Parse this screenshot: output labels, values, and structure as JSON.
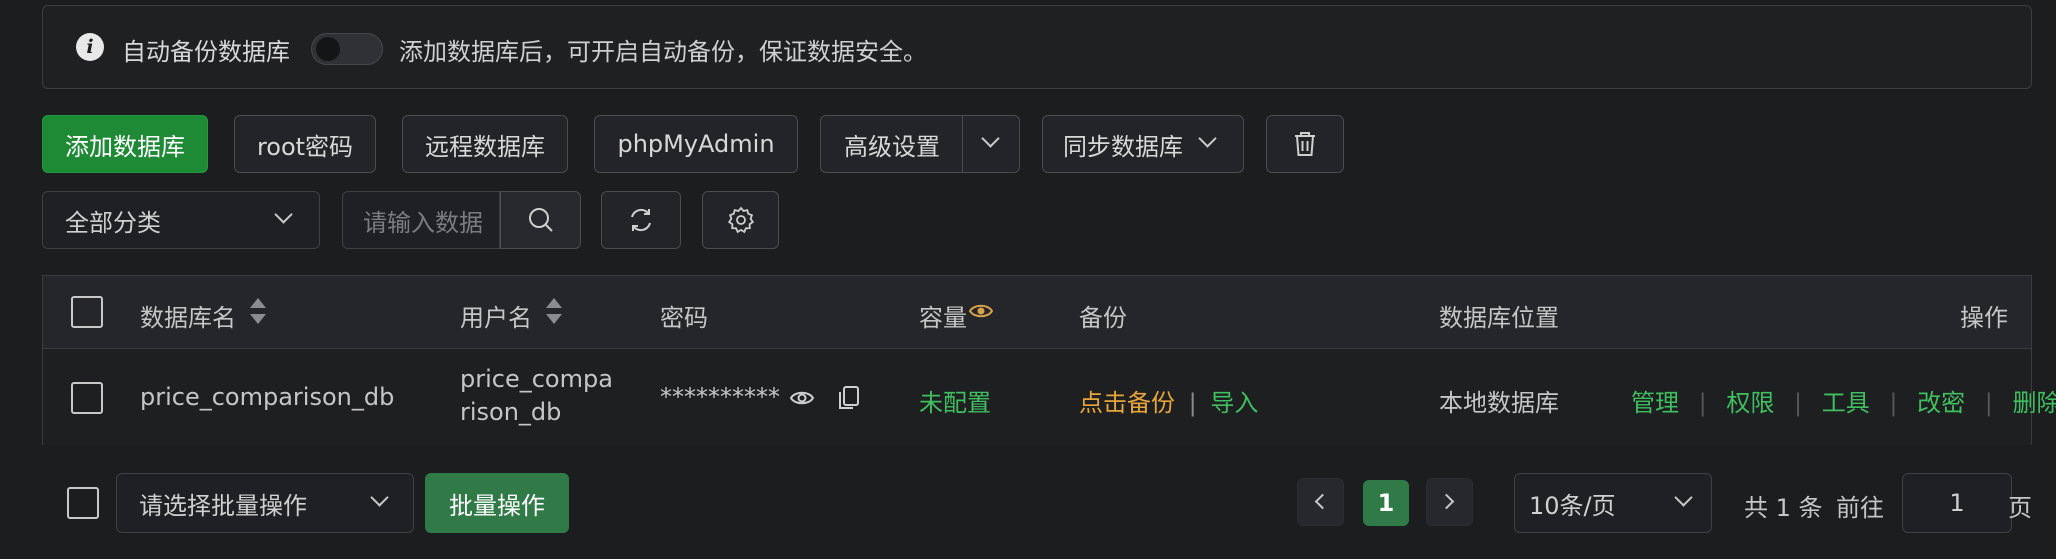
{
  "notice": {
    "label": "自动备份数据库",
    "hint": "添加数据库后，可开启自动备份，保证数据安全。",
    "toggle_on": false
  },
  "toolbar": {
    "add_db": "添加数据库",
    "root_pwd": "root密码",
    "remote_db": "远程数据库",
    "phpmyadmin": "phpMyAdmin",
    "advanced": "高级设置",
    "sync_db": "同步数据库"
  },
  "filter": {
    "category": "全部分类",
    "search_placeholder": "请输入数据"
  },
  "table": {
    "headers": {
      "name": "数据库名",
      "user": "用户名",
      "password": "密码",
      "capacity": "容量",
      "backup": "备份",
      "location": "数据库位置",
      "actions": "操作"
    },
    "rows": [
      {
        "name": "price_comparison_db",
        "user_line1": "price_compa",
        "user_line2": "rison_db",
        "password": "**********",
        "capacity": "未配置",
        "backup": "点击备份",
        "backup_sep": "|",
        "import": "导入",
        "location": "本地数据库",
        "act_manage": "管理",
        "act_perm": "权限",
        "act_tools": "工具",
        "act_chpwd": "改密",
        "act_delete": "删除",
        "act_sep": "|"
      }
    ]
  },
  "footer": {
    "batch_select": "请选择批量操作",
    "batch_btn": "批量操作",
    "current_page": "1",
    "page_size": "10条/页",
    "total": "共 1 条",
    "goto": "前往",
    "goto_value": "1",
    "page_unit": "页"
  },
  "colors": {
    "accent_green": "#1f8a36",
    "link_green": "#3fbf5f",
    "link_orange": "#e8a53c",
    "background": "#1c1d1f"
  }
}
